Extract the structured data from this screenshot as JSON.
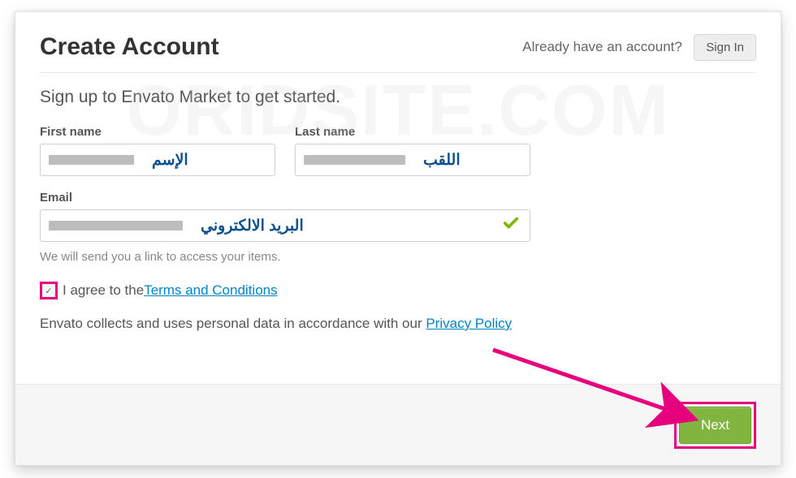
{
  "watermark": "ORIDSITE.COM",
  "header": {
    "title": "Create Account",
    "already_text": "Already have an account?",
    "signin_label": "Sign In"
  },
  "subtitle": "Sign up to Envato Market to get started.",
  "fields": {
    "first_name": {
      "label": "First name",
      "annotation": "الإسم"
    },
    "last_name": {
      "label": "Last name",
      "annotation": "اللقب"
    },
    "email": {
      "label": "Email",
      "annotation": "البريد الالكتروني",
      "valid": true
    }
  },
  "email_hint": "We will send you a link to access your items.",
  "agree": {
    "checked": true,
    "prefix": "I agree to the ",
    "link_text": "Terms and Conditions"
  },
  "privacy": {
    "prefix": "Envato collects and uses personal data in accordance with our ",
    "link_text": "Privacy Policy"
  },
  "footer": {
    "next_label": "Next"
  }
}
